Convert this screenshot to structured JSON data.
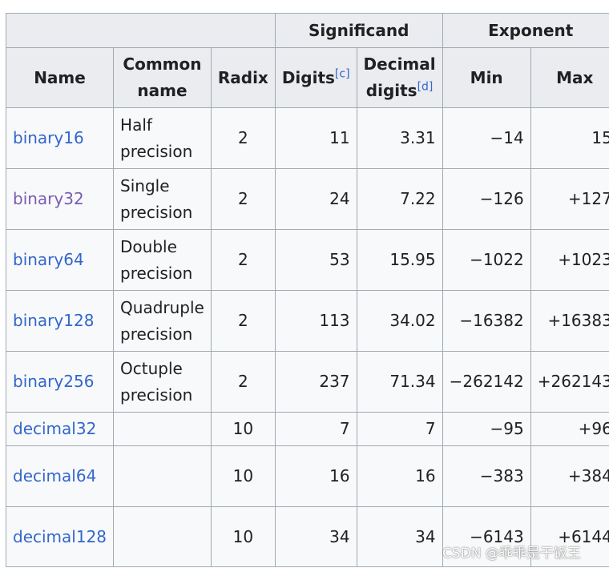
{
  "headers": {
    "group_significand": "Significand",
    "group_exponent": "Exponent",
    "name": "Name",
    "common_name": "Common name",
    "radix": "Radix",
    "digits": "Digits",
    "digits_ref": "[c]",
    "decimal_digits": "Decimal digits",
    "decimal_digits_ref": "[d]",
    "min": "Min",
    "max": "Max"
  },
  "rows": [
    {
      "name": "binary16",
      "common": "Half precision",
      "radix": "2",
      "digits": "11",
      "decimal_digits": "3.31",
      "emin": "−14",
      "emax": "15"
    },
    {
      "name": "binary32",
      "common": "Single precision",
      "radix": "2",
      "digits": "24",
      "decimal_digits": "7.22",
      "emin": "−126",
      "emax": "+127"
    },
    {
      "name": "binary64",
      "common": "Double precision",
      "radix": "2",
      "digits": "53",
      "decimal_digits": "15.95",
      "emin": "−1022",
      "emax": "+1023"
    },
    {
      "name": "binary128",
      "common": "Quadruple precision",
      "radix": "2",
      "digits": "113",
      "decimal_digits": "34.02",
      "emin": "−16382",
      "emax": "+16383"
    },
    {
      "name": "binary256",
      "common": "Octuple precision",
      "radix": "2",
      "digits": "237",
      "decimal_digits": "71.34",
      "emin": "−262142",
      "emax": "+262143"
    },
    {
      "name": "decimal32",
      "common": "",
      "radix": "10",
      "digits": "7",
      "decimal_digits": "7",
      "emin": "−95",
      "emax": "+96"
    },
    {
      "name": "decimal64",
      "common": "",
      "radix": "10",
      "digits": "16",
      "decimal_digits": "16",
      "emin": "−383",
      "emax": "+384"
    },
    {
      "name": "decimal128",
      "common": "",
      "radix": "10",
      "digits": "34",
      "decimal_digits": "34",
      "emin": "−6143",
      "emax": "+6144"
    }
  ],
  "watermark": "CSDN @乖乖是干饭王",
  "colors": {
    "link": "#3366cc",
    "visited_link": "#795cb2",
    "header_bg": "#eaecf0",
    "cell_bg": "#f8f9fa",
    "border": "#a2a9b1"
  }
}
